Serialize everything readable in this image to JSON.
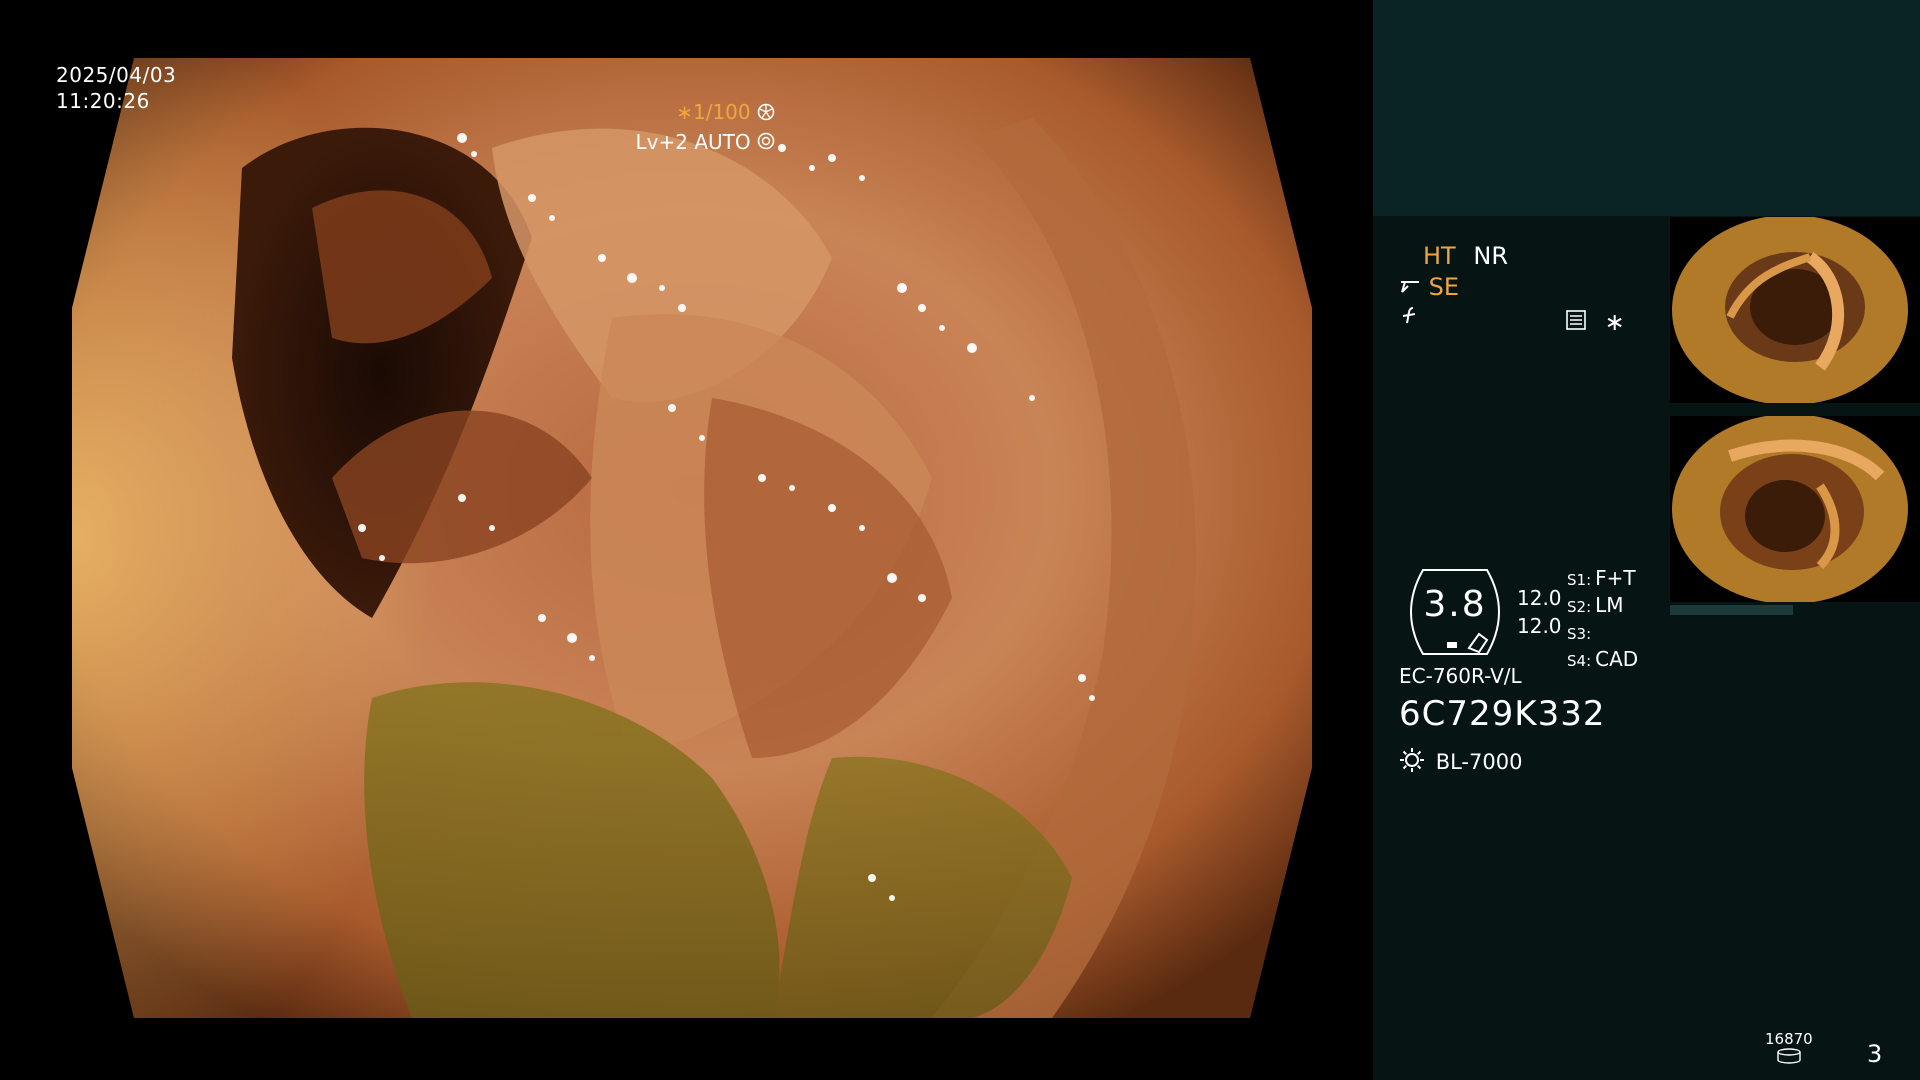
{
  "overlay": {
    "date": "2025/04/03",
    "time": "11:20:26",
    "shutter": "∗1/100",
    "level": "Lv+2 AUTO"
  },
  "settings": {
    "ht": "HT",
    "nr": "NR",
    "se": "SE",
    "ruler_value": "3.8",
    "sub_value_1": "12.0",
    "sub_value_2": "12.0",
    "s1_key": "S1:",
    "s1_value": "F+T",
    "s2_key": "S2:",
    "s2_value": "LM",
    "s3_key": "S3:",
    "s3_value": "",
    "s4_key": "S4:",
    "s4_value": "CAD",
    "star": "∗"
  },
  "device": {
    "model": "EC-760R-V/L",
    "serial": "6C729K332",
    "light_source": "BL-7000"
  },
  "footer": {
    "counter": "16870",
    "page": "3"
  },
  "colors": {
    "accent": "#f0a640",
    "panel_bg": "#061414",
    "panel_top": "#0a2426"
  },
  "icons": [
    "scissors-icon",
    "function-icon",
    "menu-icon",
    "light-source-icon",
    "database-icon",
    "aperture-icon",
    "sun-ring-icon"
  ]
}
